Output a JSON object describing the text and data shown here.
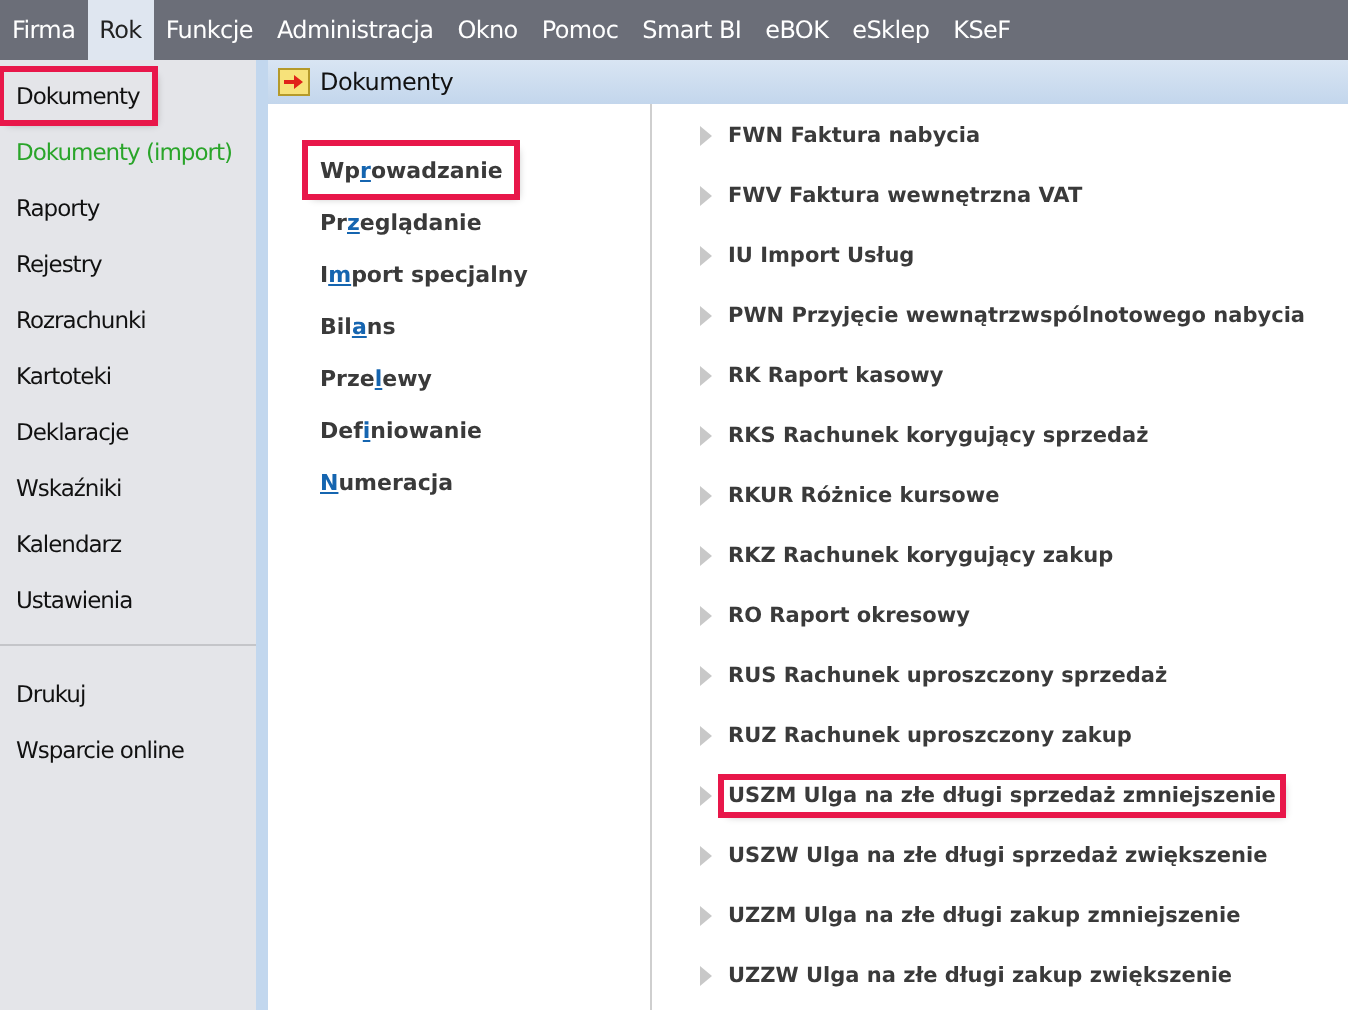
{
  "menu": [
    {
      "label": "Firma",
      "selected": false
    },
    {
      "label": "Rok",
      "selected": true
    },
    {
      "label": "Funkcje",
      "selected": false
    },
    {
      "label": "Administracja",
      "selected": false
    },
    {
      "label": "Okno",
      "selected": false
    },
    {
      "label": "Pomoc",
      "selected": false
    },
    {
      "label": "Smart BI",
      "selected": false
    },
    {
      "label": "eBOK",
      "selected": false
    },
    {
      "label": "eSklep",
      "selected": false
    },
    {
      "label": "KSeF",
      "selected": false
    }
  ],
  "sidebar": {
    "groups": [
      [
        {
          "label": "Dokumenty",
          "highlighted": true,
          "color": "#111111"
        },
        {
          "label": "Dokumenty (import)",
          "highlighted": false,
          "color": "#2aa52a"
        },
        {
          "label": "Raporty",
          "highlighted": false,
          "color": "#111111"
        },
        {
          "label": "Rejestry",
          "highlighted": false,
          "color": "#111111"
        },
        {
          "label": "Rozrachunki",
          "highlighted": false,
          "color": "#111111"
        },
        {
          "label": "Kartoteki",
          "highlighted": false,
          "color": "#111111"
        },
        {
          "label": "Deklaracje",
          "highlighted": false,
          "color": "#111111"
        },
        {
          "label": "Wskaźniki",
          "highlighted": false,
          "color": "#111111"
        },
        {
          "label": "Kalendarz",
          "highlighted": false,
          "color": "#111111"
        },
        {
          "label": "Ustawienia",
          "highlighted": false,
          "color": "#111111"
        }
      ],
      [
        {
          "label": "Drukuj",
          "highlighted": false,
          "color": "#111111"
        },
        {
          "label": "Wsparcie online",
          "highlighted": false,
          "color": "#111111"
        }
      ]
    ]
  },
  "panel": {
    "title": "Dokumenty",
    "actions": [
      {
        "parts": [
          {
            "kind": "plain",
            "text": "Wp"
          },
          {
            "kind": "key",
            "text": "r"
          },
          {
            "kind": "plain",
            "text": "owadzanie"
          }
        ],
        "highlighted": true
      },
      {
        "parts": [
          {
            "kind": "plain",
            "text": "Pr"
          },
          {
            "kind": "key",
            "text": "z"
          },
          {
            "kind": "plain",
            "text": "eglądanie"
          }
        ],
        "highlighted": false
      },
      {
        "parts": [
          {
            "kind": "plain",
            "text": "I"
          },
          {
            "kind": "key",
            "text": "m"
          },
          {
            "kind": "plain",
            "text": "port specjalny"
          }
        ],
        "highlighted": false
      },
      {
        "parts": [
          {
            "kind": "plain",
            "text": "Bil"
          },
          {
            "kind": "key",
            "text": "a"
          },
          {
            "kind": "plain",
            "text": "ns"
          }
        ],
        "highlighted": false
      },
      {
        "parts": [
          {
            "kind": "plain",
            "text": "Prze"
          },
          {
            "kind": "key",
            "text": "l"
          },
          {
            "kind": "plain",
            "text": "ewy"
          }
        ],
        "highlighted": false
      },
      {
        "parts": [
          {
            "kind": "plain",
            "text": "Def"
          },
          {
            "kind": "key",
            "text": "i"
          },
          {
            "kind": "plain",
            "text": "niowanie"
          }
        ],
        "highlighted": false
      },
      {
        "parts": [
          {
            "kind": "key",
            "text": "N"
          },
          {
            "kind": "plain",
            "text": "umeracja"
          }
        ],
        "highlighted": false
      }
    ],
    "documents": [
      {
        "label": "FWN Faktura nabycia",
        "highlighted": false
      },
      {
        "label": "FWV Faktura wewnętrzna VAT",
        "highlighted": false
      },
      {
        "label": "IU Import Usług",
        "highlighted": false
      },
      {
        "label": "PWN Przyjęcie wewnątrzwspólnotowego nabycia",
        "highlighted": false
      },
      {
        "label": "RK Raport kasowy",
        "highlighted": false
      },
      {
        "label": "RKS Rachunek korygujący sprzedaż",
        "highlighted": false
      },
      {
        "label": "RKUR Różnice kursowe",
        "highlighted": false
      },
      {
        "label": "RKZ Rachunek korygujący zakup",
        "highlighted": false
      },
      {
        "label": "RO Raport okresowy",
        "highlighted": false
      },
      {
        "label": "RUS Rachunek uproszczony sprzedaż",
        "highlighted": false
      },
      {
        "label": "RUZ Rachunek uproszczony zakup",
        "highlighted": false
      },
      {
        "label": "USZM Ulga na złe długi sprzedaż zmniejszenie",
        "highlighted": true
      },
      {
        "label": "USZW Ulga na złe długi sprzedaż zwiększenie",
        "highlighted": false
      },
      {
        "label": "UZZM Ulga na złe długi zakup zmniejszenie",
        "highlighted": false
      },
      {
        "label": "UZZW Ulga na złe długi zakup zwiększenie",
        "highlighted": false
      }
    ]
  }
}
